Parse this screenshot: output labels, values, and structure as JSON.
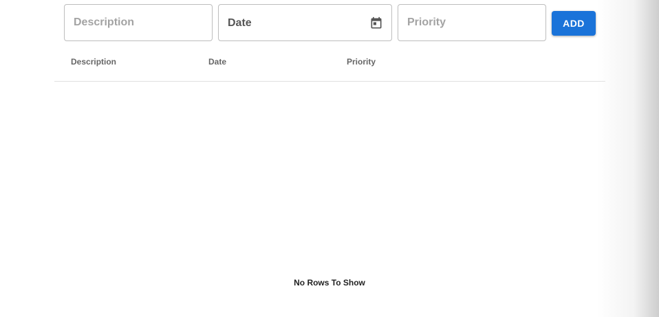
{
  "form": {
    "description_placeholder": "Description",
    "date_value": "Date",
    "priority_placeholder": "Priority",
    "add_label": "ADD"
  },
  "grid": {
    "columns": [
      "Description",
      "Date",
      "Priority"
    ],
    "rows": [],
    "empty_message": "No Rows To Show"
  },
  "icons": {
    "date_icon": "calendar-icon"
  },
  "colors": {
    "accent": "#1a73d9",
    "field_border": "#bdbdbd",
    "divider": "#e0e0e0"
  }
}
